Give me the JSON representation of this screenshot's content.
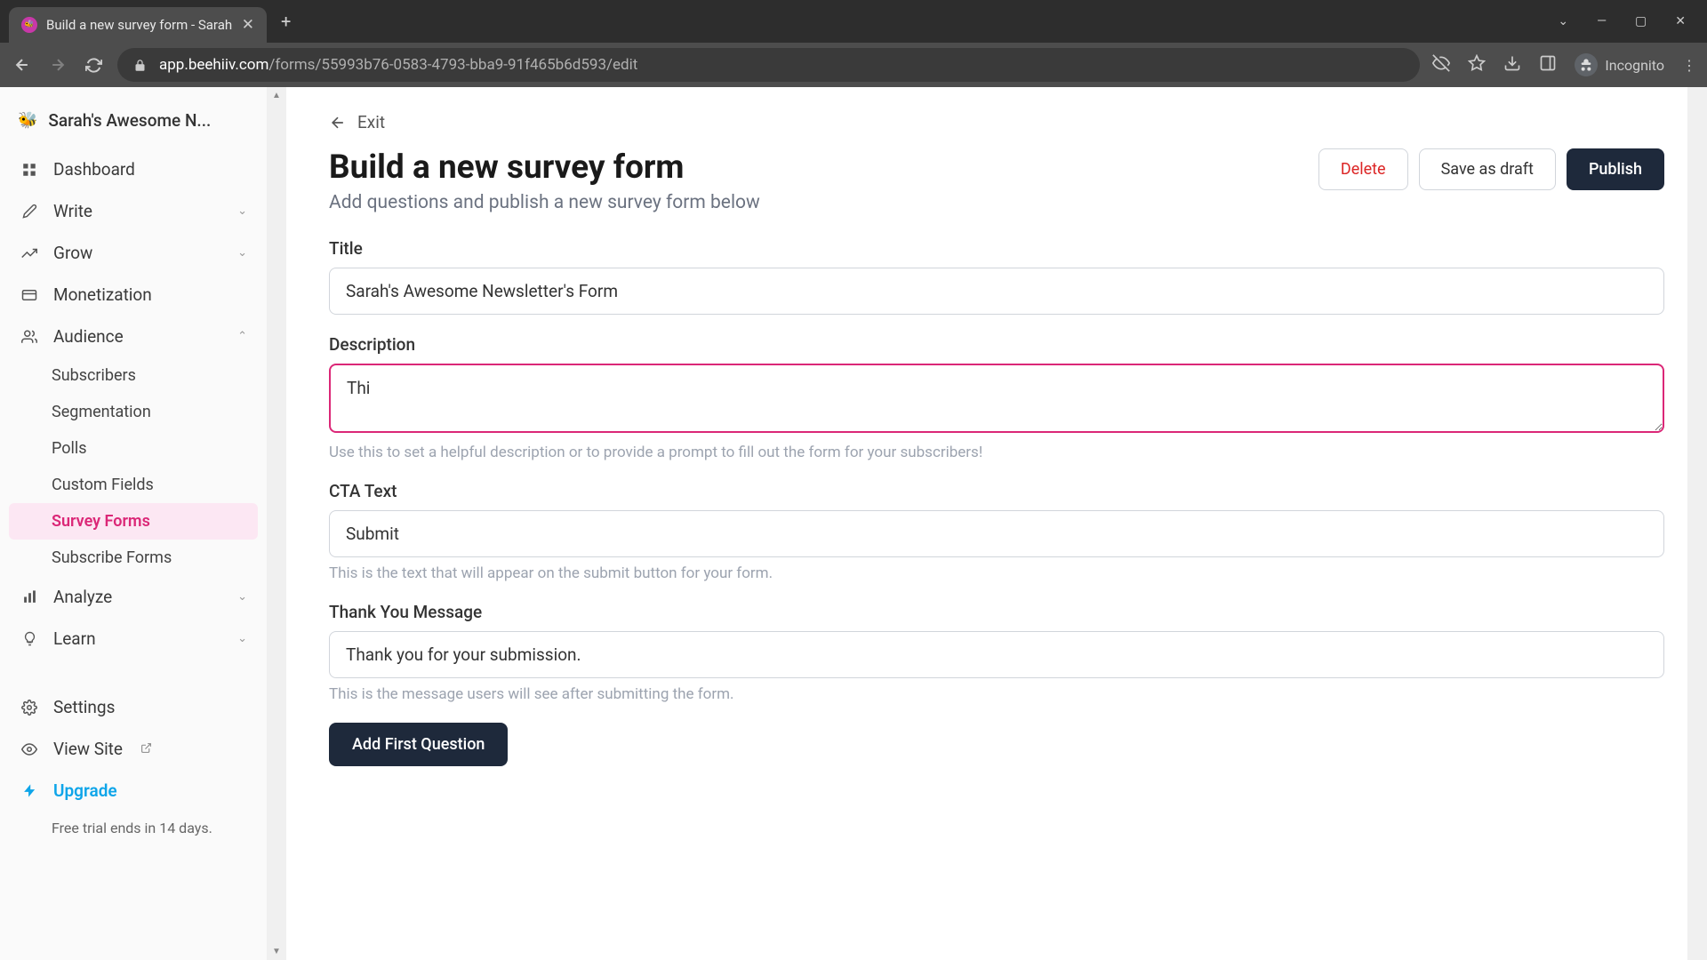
{
  "browser": {
    "tab_title": "Build a new survey form - Sarah",
    "url_domain": "app.beehiiv.com",
    "url_path": "/forms/55993b76-0583-4793-bba9-91f465b6d593/edit",
    "incognito": "Incognito"
  },
  "sidebar": {
    "workspace": "Sarah's Awesome N...",
    "items": [
      {
        "label": "Dashboard",
        "icon": "dashboard"
      },
      {
        "label": "Write",
        "icon": "pencil",
        "expandable": true
      },
      {
        "label": "Grow",
        "icon": "trend",
        "expandable": true
      },
      {
        "label": "Monetization",
        "icon": "card"
      },
      {
        "label": "Audience",
        "icon": "users",
        "expanded": true
      }
    ],
    "audience_sub": [
      "Subscribers",
      "Segmentation",
      "Polls",
      "Custom Fields",
      "Survey Forms",
      "Subscribe Forms"
    ],
    "active_sub": "Survey Forms",
    "items2": [
      {
        "label": "Analyze",
        "icon": "chart",
        "expandable": true
      },
      {
        "label": "Learn",
        "icon": "bulb",
        "expandable": true
      }
    ],
    "settings": "Settings",
    "view_site": "View Site",
    "upgrade": "Upgrade",
    "trial": "Free trial ends in 14 days."
  },
  "main": {
    "exit": "Exit",
    "title": "Build a new survey form",
    "subtitle": "Add questions and publish a new survey form below",
    "actions": {
      "delete": "Delete",
      "draft": "Save as draft",
      "publish": "Publish"
    },
    "fields": {
      "title_label": "Title",
      "title_value": "Sarah's Awesome Newsletter's Form",
      "desc_label": "Description",
      "desc_value": "Thi",
      "desc_help": "Use this to set a helpful description or to provide a prompt to fill out the form for your subscribers!",
      "cta_label": "CTA Text",
      "cta_value": "Submit",
      "cta_help": "This is the text that will appear on the submit button for your form.",
      "thanks_label": "Thank You Message",
      "thanks_value": "Thank you for your submission.",
      "thanks_help": "This is the message users will see after submitting the form."
    },
    "add_first": "Add First Question"
  }
}
